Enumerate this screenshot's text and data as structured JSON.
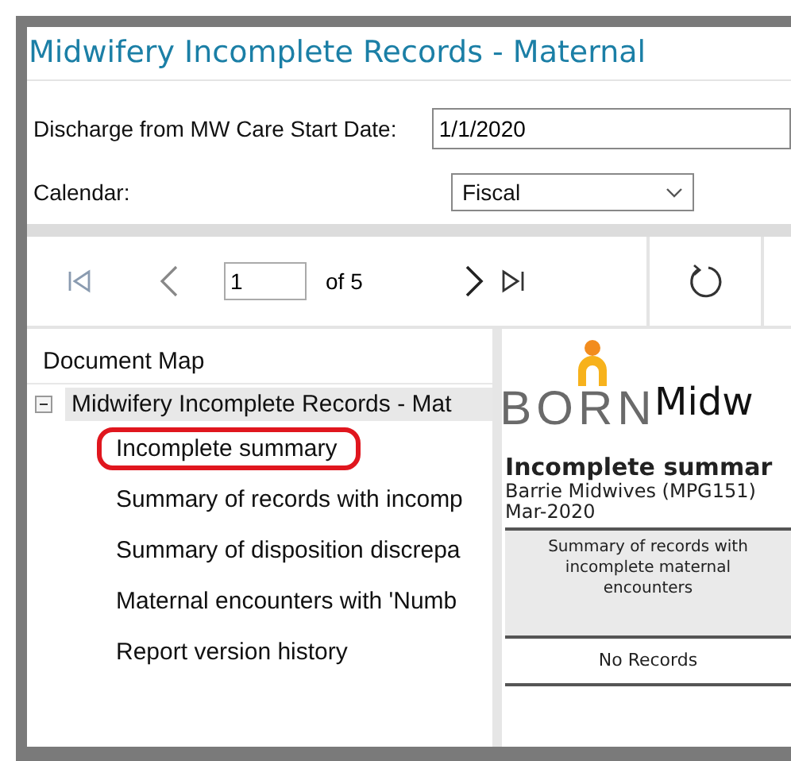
{
  "window": {
    "title": "Midwifery Incomplete Records - Maternal"
  },
  "parameters": [
    {
      "kind": "text",
      "label": "Discharge from MW Care Start Date:",
      "value": "1/1/2020"
    },
    {
      "kind": "dropdown",
      "label": "Calendar:",
      "value": "Fiscal"
    }
  ],
  "toolbar": {
    "page": "1",
    "page_count": "of 5"
  },
  "document_map": {
    "title": "Document Map",
    "items": [
      {
        "label": "Midwifery Incomplete Records - Mat",
        "expanded": true,
        "selected": true,
        "children": [
          {
            "label": "Incomplete summary",
            "selected": false,
            "highlighted": true
          },
          {
            "label": "Summary of records with incomp",
            "selected": false,
            "highlighted": false
          },
          {
            "label": "Summary of disposition discrepa",
            "selected": false,
            "highlighted": false
          },
          {
            "label": "Maternal encounters with 'Numb",
            "selected": false,
            "highlighted": false
          },
          {
            "label": "Report version history",
            "selected": false,
            "highlighted": false
          }
        ]
      }
    ]
  },
  "report": {
    "logo": "BORN",
    "heading": "Midw",
    "subtitle": "Incomplete summar",
    "organization": "Barrie Midwives (MPG151)",
    "period": "Mar-2020",
    "table": {
      "header": "Summary of records with incomplete maternal encounters",
      "empty": "No Records"
    }
  }
}
